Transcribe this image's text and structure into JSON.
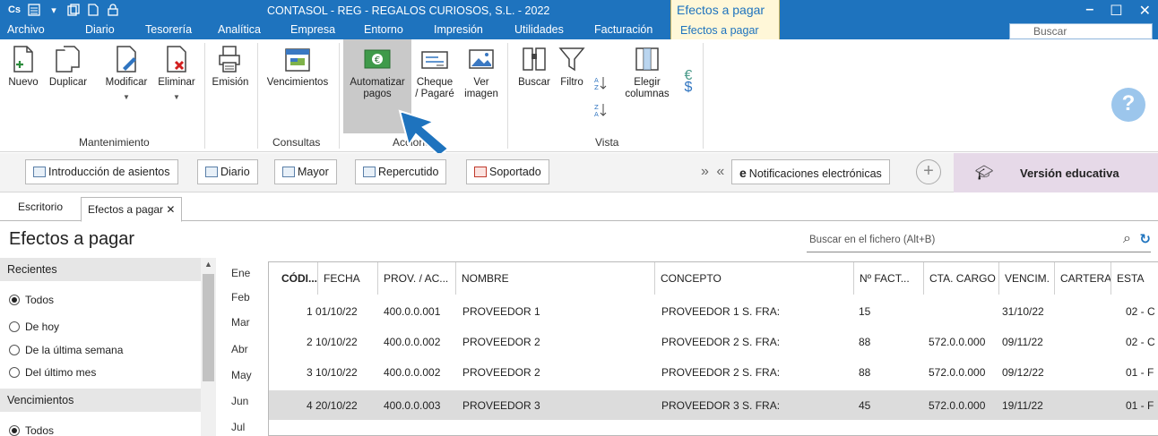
{
  "titlebar": {
    "title": "CONTASOL - REG - REGALOS CURIOSOS, S.L. - 2022",
    "context_tab": "Efectos a pagar",
    "app_glyph": "Cs",
    "window_controls": [
      "–",
      "☐",
      "✕"
    ]
  },
  "menu": {
    "items": [
      "Archivo",
      "Diario",
      "Tesorería",
      "Analítica",
      "Empresa",
      "Entorno",
      "Impresión",
      "Utilidades",
      "Facturación",
      "Efectos a pagar"
    ],
    "search_placeholder": "Buscar"
  },
  "ribbon": {
    "buttons": {
      "nuevo": "Nuevo",
      "duplicar": "Duplicar",
      "modificar": "Modificar",
      "eliminar": "Eliminar",
      "emision": "Emisión",
      "vencimientos": "Vencimientos",
      "automatizar_1": "Automatizar",
      "automatizar_2": "pagos",
      "cheque_1": "Cheque",
      "cheque_2": "/ Pagaré",
      "ver_1": "Ver",
      "ver_2": "imagen",
      "buscar": "Buscar",
      "filtro": "Filtro",
      "elegir_1": "Elegir",
      "elegir_2": "columnas"
    },
    "groups": {
      "mantenimiento": "Mantenimiento",
      "consultas": "Consultas",
      "acciones": "Acciones",
      "vista": "Vista"
    },
    "help": "?"
  },
  "shortcuts": {
    "introduccion": "Introducción de asientos",
    "diario": "Diario",
    "mayor": "Mayor",
    "repercutido": "Repercutido",
    "soportado": "Soportado",
    "arrows": "» «",
    "notificaciones": "Notificaciones electrónicas",
    "plus": "+",
    "version": "Versión educativa"
  },
  "doc_tabs": {
    "escritorio": "Escritorio",
    "efectos": "Efectos a pagar ✕"
  },
  "page": {
    "title": "Efectos a pagar",
    "search_placeholder": "Buscar en el fichero (Alt+B)"
  },
  "left_panel": {
    "recientes_header": "Recientes",
    "recientes": [
      "Todos",
      "De hoy",
      "De la última semana",
      "Del último mes"
    ],
    "vencimientos_header": "Vencimientos",
    "vencimientos": [
      "Todos"
    ]
  },
  "months": [
    "Ene",
    "Feb",
    "Mar",
    "Abr",
    "May",
    "Jun",
    "Jul"
  ],
  "table": {
    "headers": {
      "codigo": "CÓDI...",
      "fecha": "FECHA",
      "prov": "PROV. / AC...",
      "nombre": "NOMBRE",
      "concepto": "CONCEPTO",
      "nfact": "Nº FACT...",
      "cta": "CTA. CARGO",
      "vencim": "VENCIM.",
      "cartera": "CARTERA",
      "estado": "ESTA"
    },
    "rows": [
      {
        "codigo": "1",
        "fecha": "01/10/22",
        "prov": "400.0.0.001",
        "nombre": "PROVEEDOR 1",
        "concepto": "PROVEEDOR 1 S. FRA:",
        "nfact": "15",
        "cta": "",
        "vencim": "31/10/22",
        "cartera": "",
        "estado": "02 - C"
      },
      {
        "codigo": "2",
        "fecha": "10/10/22",
        "prov": "400.0.0.002",
        "nombre": "PROVEEDOR 2",
        "concepto": "PROVEEDOR 2 S. FRA:",
        "nfact": "88",
        "cta": "572.0.0.000",
        "vencim": "09/11/22",
        "cartera": "",
        "estado": "02 - C"
      },
      {
        "codigo": "3",
        "fecha": "10/10/22",
        "prov": "400.0.0.002",
        "nombre": "PROVEEDOR 2",
        "concepto": "PROVEEDOR 2 S. FRA:",
        "nfact": "88",
        "cta": "572.0.0.000",
        "vencim": "09/12/22",
        "cartera": "",
        "estado": "01 - F"
      },
      {
        "codigo": "4",
        "fecha": "20/10/22",
        "prov": "400.0.0.003",
        "nombre": "PROVEEDOR 3",
        "concepto": "PROVEEDOR 3 S. FRA:",
        "nfact": "45",
        "cta": "572.0.0.000",
        "vencim": "19/11/22",
        "cartera": "",
        "estado": "01 - F"
      }
    ]
  },
  "colors": {
    "accent": "#1e73be",
    "context_tab": "#fff7d8",
    "edu_banner": "#e6d9e8",
    "selected_row": "#dcdcdc"
  }
}
